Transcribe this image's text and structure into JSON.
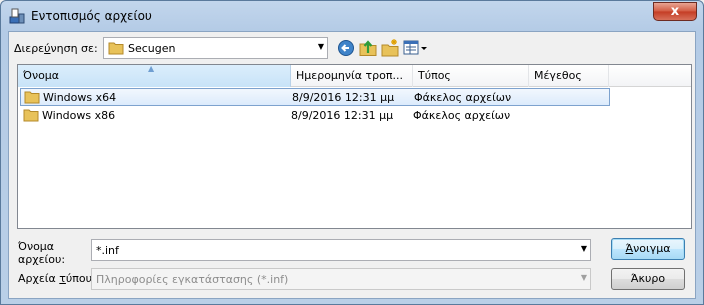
{
  "window": {
    "title": "Εντοπισμός αρχείου",
    "close_glyph": "x"
  },
  "toolbar": {
    "lookin_label_pre": "Διερε",
    "lookin_label_accel": "ύ",
    "lookin_label_post": "νηση σε:",
    "lookin_value": "Secugen",
    "icons": [
      "back-icon",
      "up-folder-icon",
      "new-folder-icon",
      "view-menu-icon"
    ]
  },
  "list": {
    "columns": [
      "Όνομα",
      "Ημερομηνία τροπ...",
      "Τύπος",
      "Μέγεθος"
    ],
    "rows": [
      {
        "name": "Windows x64",
        "date": "8/9/2016 12:31 μμ",
        "type": "Φάκελος αρχείων",
        "size": "",
        "selected": true
      },
      {
        "name": "Windows x86",
        "date": "8/9/2016 12:31 μμ",
        "type": "Φάκελος αρχείων",
        "size": "",
        "selected": false
      }
    ]
  },
  "filename": {
    "label_line1": "Όνομα",
    "label_line2": "αρχείου:",
    "value": "*.inf"
  },
  "filetype": {
    "label_pre": "Αρχεία ",
    "label_accel": "τ",
    "label_post": "ύπου:",
    "value": "Πληροφορίες εγκατάστασης (*.inf)"
  },
  "buttons": {
    "open_accel": "Ά",
    "open_rest": "νοιγμα",
    "cancel": "Άκυρο"
  },
  "colors": {
    "titlebar": "#b9cfe7",
    "close_red": "#c43c24",
    "selection": "#dcebfc",
    "folder": "#e8c25a"
  }
}
